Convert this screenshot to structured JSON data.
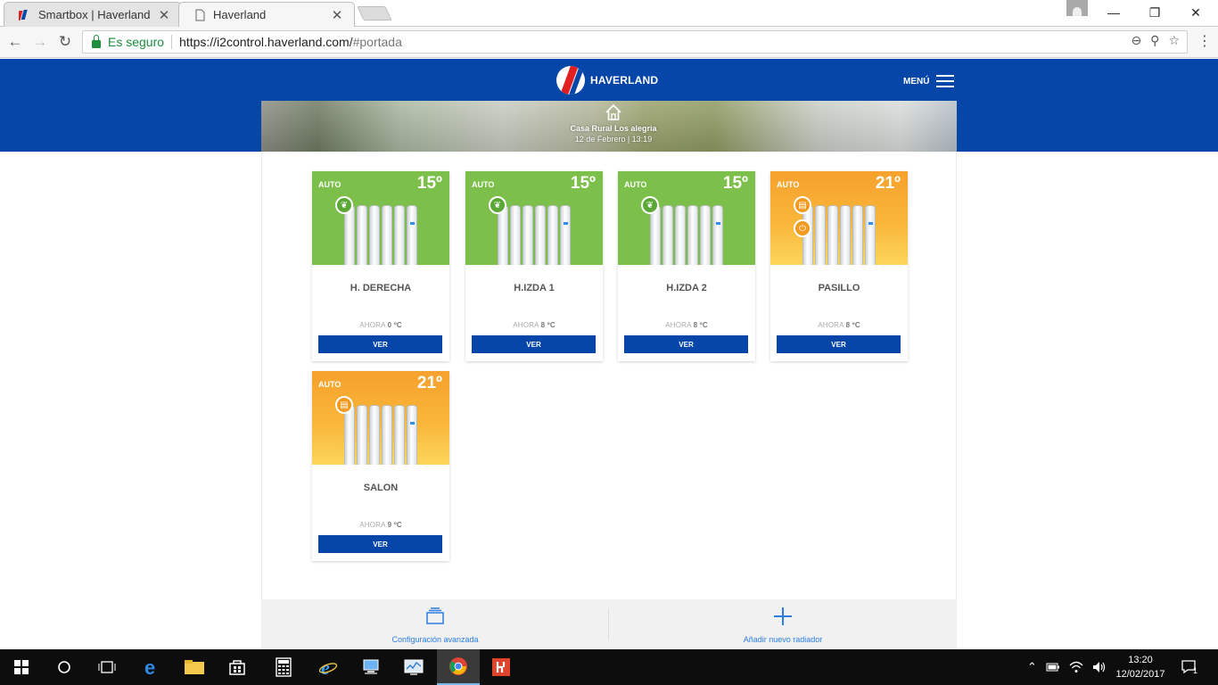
{
  "browser": {
    "tabs": [
      {
        "title": "Smartbox | Haverland",
        "active": false
      },
      {
        "title": "Haverland",
        "active": true
      }
    ],
    "security_label": "Es seguro",
    "url_host": "https://i2control.haverland.com/",
    "url_path": "#portada"
  },
  "header": {
    "brand": "HAVERLAND",
    "menu_label": "MENÚ",
    "home_title": "Casa Rural Los alegria",
    "date": "12 de Febrero | 13:19"
  },
  "cards": [
    {
      "name": "H. DERECHA",
      "mode": "AUTO",
      "setpoint": "15º",
      "theme": "green",
      "now_label": "AHORA",
      "now_value": "0 ºC",
      "button": "VER",
      "badges": [
        "leaf-icon"
      ]
    },
    {
      "name": "H.IZDA 1",
      "mode": "AUTO",
      "setpoint": "15º",
      "theme": "green",
      "now_label": "AHORA",
      "now_value": "8 ºC",
      "button": "VER",
      "badges": [
        "leaf-icon"
      ]
    },
    {
      "name": "H.IZDA 2",
      "mode": "AUTO",
      "setpoint": "15º",
      "theme": "green",
      "now_label": "AHORA",
      "now_value": "8 ºC",
      "button": "VER",
      "badges": [
        "leaf-icon"
      ]
    },
    {
      "name": "PASILLO",
      "mode": "AUTO",
      "setpoint": "21º",
      "theme": "orange",
      "now_label": "AHORA",
      "now_value": "8 ºC",
      "button": "VER",
      "badges": [
        "radiator-icon",
        "power-icon"
      ]
    },
    {
      "name": "SALON",
      "mode": "AUTO",
      "setpoint": "21º",
      "theme": "orange",
      "now_label": "AHORA",
      "now_value": "9 ºC",
      "button": "VER",
      "badges": [
        "radiator-icon"
      ]
    }
  ],
  "footer": {
    "advanced": "Configuración avanzada",
    "add": "Añadir nuevo radiador"
  },
  "taskbar": {
    "time": "13:20",
    "date": "12/02/2017",
    "notifications": "1"
  },
  "colors": {
    "brand_blue": "#0546a8",
    "eco_green": "#7cbf4a",
    "comfort_orange": "#f6a12d",
    "link_blue": "#2a7ee0"
  }
}
